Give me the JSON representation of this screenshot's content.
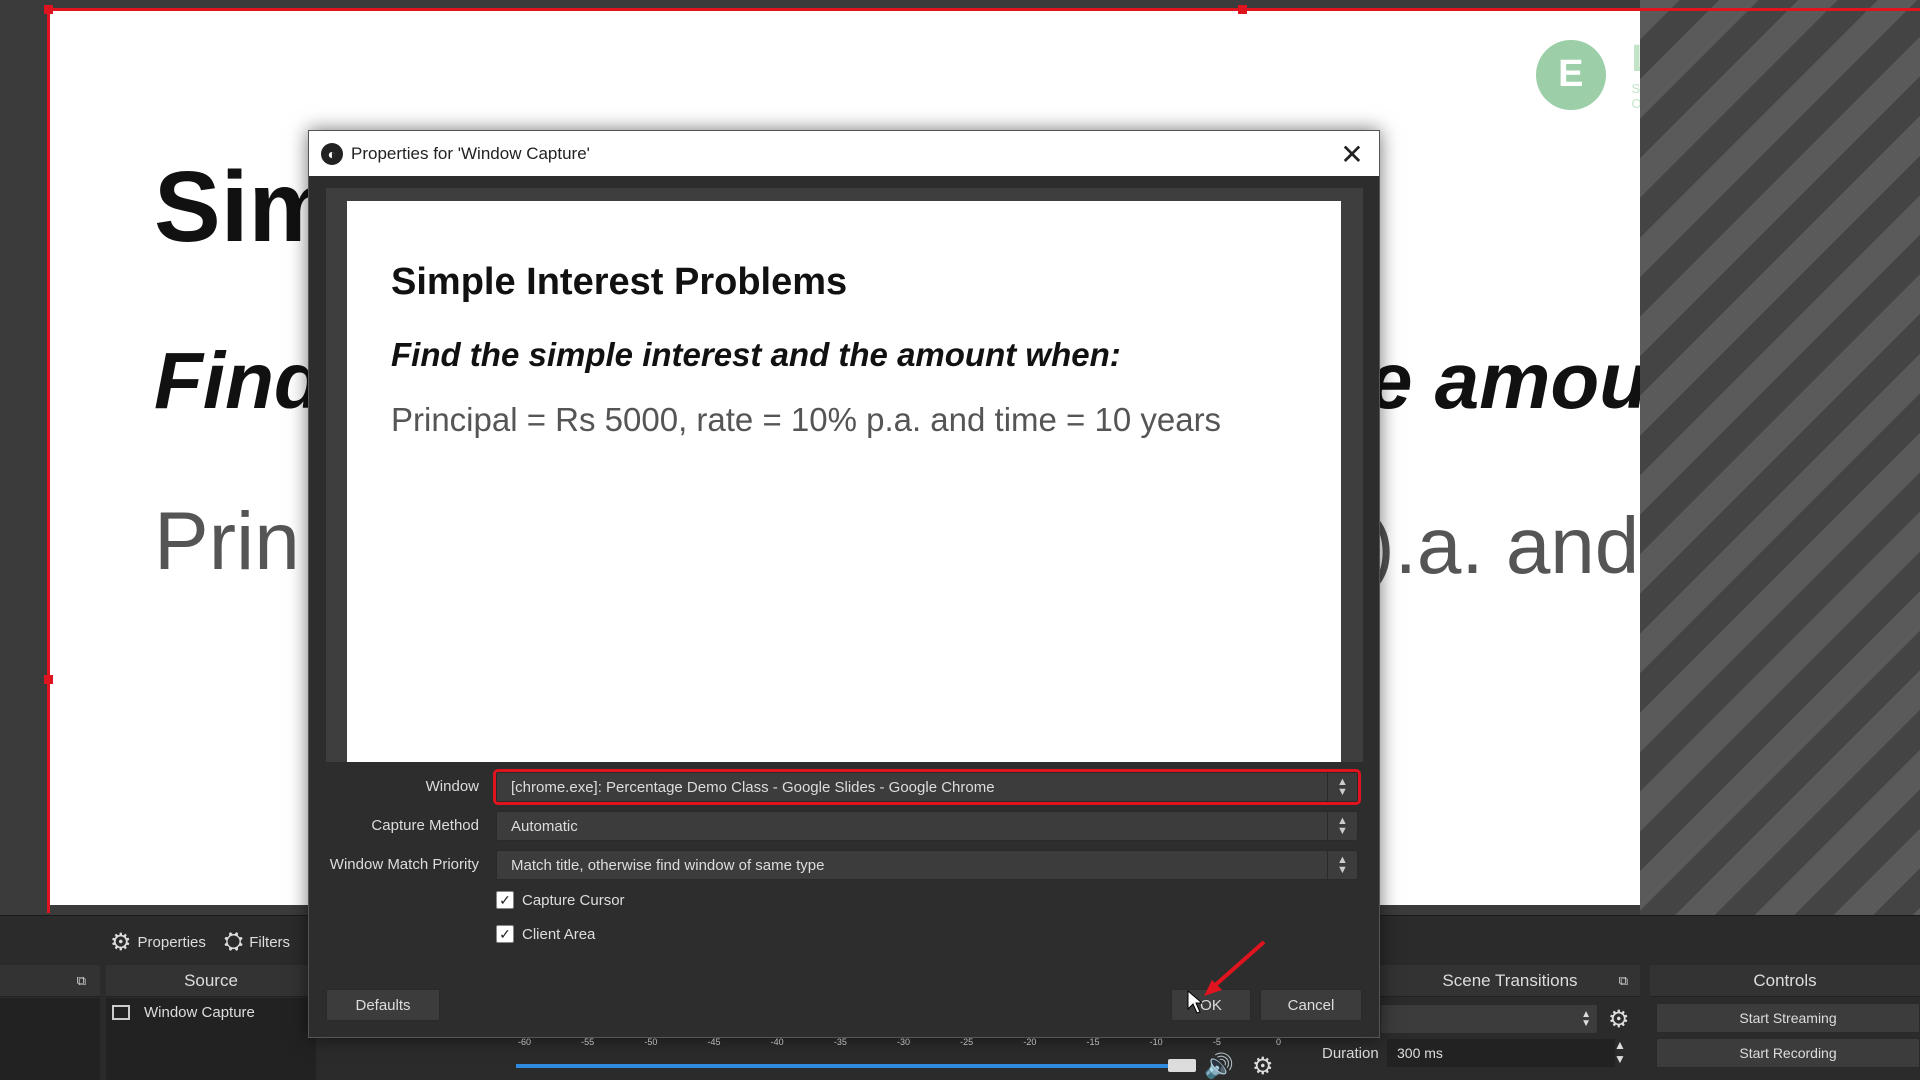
{
  "preview": {
    "slide_title": "Sim",
    "slide_subtitle_left": "Find",
    "slide_subtitle_right": "e amou",
    "slide_body_left": "Prin",
    "slide_body_right": ").a. and",
    "logo": {
      "letter": "E",
      "name": "LEARNYST",
      "tagline": "SELL COURSES ONLINE"
    }
  },
  "toolbar": {
    "properties_label": "Properties",
    "filters_label": "Filters"
  },
  "docks": {
    "sources_title": "Source",
    "source_item": "Window Capture",
    "scene_transitions_title": "Scene Transitions",
    "duration_label": "Duration",
    "duration_value": "300 ms",
    "controls_title": "Controls",
    "start_streaming": "Start Streaming",
    "start_recording": "Start Recording",
    "mixer_ticks": [
      "-60",
      "-55",
      "-50",
      "-45",
      "-40",
      "-35",
      "-30",
      "-25",
      "-20",
      "-15",
      "-10",
      "-5",
      "0"
    ]
  },
  "dialog": {
    "title": "Properties for 'Window Capture'",
    "preview_slide": {
      "title": "Simple Interest Problems",
      "subtitle": "Find the simple interest and the amount when:",
      "body": "Principal = Rs 5000, rate = 10% p.a. and time = 10 years"
    },
    "window_label": "Window",
    "window_value": "[chrome.exe]: Percentage Demo Class - Google Slides - Google Chrome",
    "capture_method_label": "Capture Method",
    "capture_method_value": "Automatic",
    "match_priority_label": "Window Match Priority",
    "match_priority_value": "Match title, otherwise find window of same type",
    "capture_cursor_label": "Capture Cursor",
    "capture_cursor_checked": true,
    "client_area_label": "Client Area",
    "client_area_checked": true,
    "defaults_button": "Defaults",
    "ok_button": "OK",
    "cancel_button": "Cancel"
  },
  "colors": {
    "highlight": "#e0141e",
    "panel": "#2b2b2b",
    "button": "#3c3c3c",
    "logo_green": "#7bc08a"
  }
}
